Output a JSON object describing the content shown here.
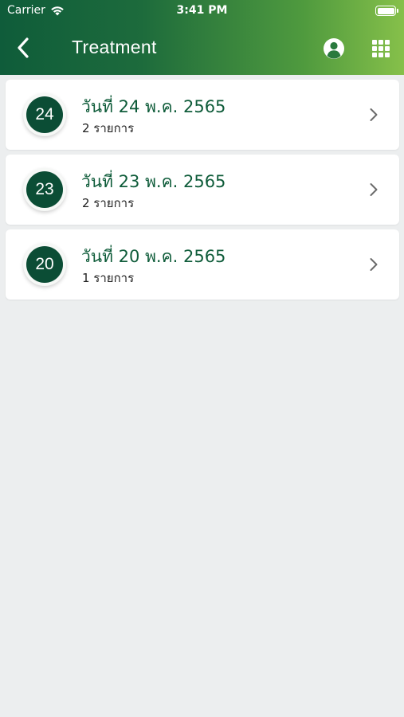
{
  "status_bar": {
    "carrier": "Carrier",
    "time": "3:41 PM"
  },
  "nav": {
    "title": "Treatment",
    "back_icon": "chevron-left-icon",
    "profile_icon": "user-circle-icon",
    "apps_icon": "grid-icon"
  },
  "colors": {
    "header_gradient_start": "#0f5c3a",
    "header_gradient_end": "#86c04a",
    "accent": "#0b4d35",
    "background": "#eceeef"
  },
  "treatments": [
    {
      "day": "24",
      "title": "วันที่ 24 พ.ค. 2565",
      "count_label": "2 รายการ"
    },
    {
      "day": "23",
      "title": "วันที่ 23 พ.ค. 2565",
      "count_label": "2 รายการ"
    },
    {
      "day": "20",
      "title": "วันที่ 20 พ.ค. 2565",
      "count_label": "1 รายการ"
    }
  ]
}
